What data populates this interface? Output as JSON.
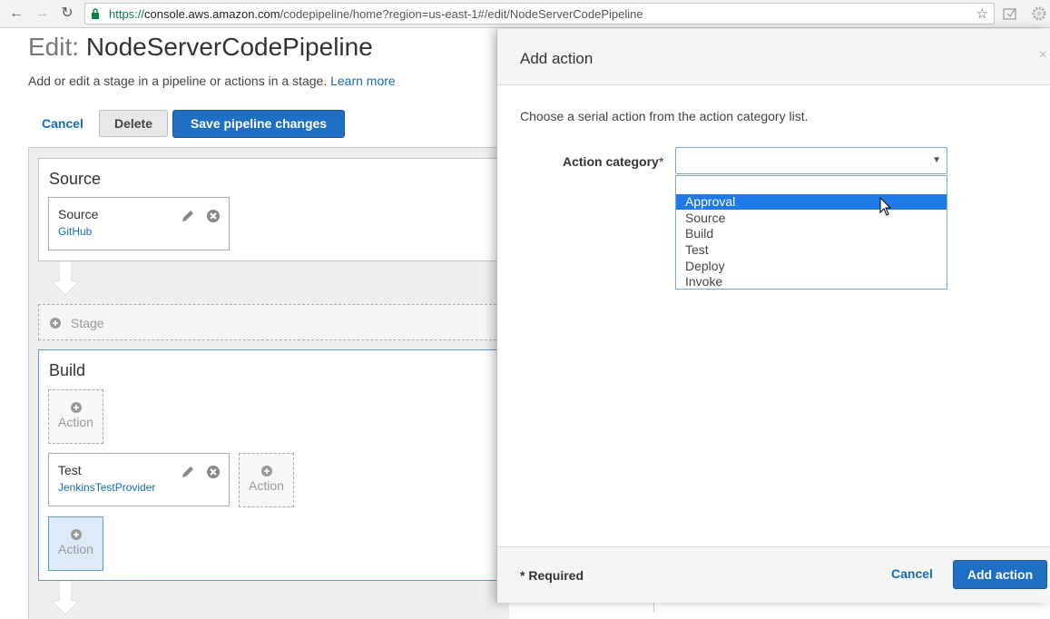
{
  "browser": {
    "url_scheme": "https://",
    "url_host": "console.aws.amazon.com",
    "url_path": "/codepipeline/home?region=us-east-1#/edit/NodeServerCodePipeline"
  },
  "page": {
    "title_prefix": "Edit:",
    "title_name": "NodeServerCodePipeline",
    "subtitle": "Add or edit a stage in a pipeline or actions in a stage.",
    "learn_more": "Learn more",
    "cancel_label": "Cancel",
    "delete_label": "Delete",
    "save_label": "Save pipeline changes"
  },
  "pipeline": {
    "source_stage": {
      "title": "Source",
      "action_name": "Source",
      "action_provider": "GitHub"
    },
    "add_stage_label": "Stage",
    "build_stage": {
      "title": "Build",
      "action_label": "Action",
      "test_action_name": "Test",
      "test_action_provider": "JenkinsTestProvider"
    }
  },
  "modal": {
    "title": "Add action",
    "close": "×",
    "instruction": "Choose a serial action from the action category list.",
    "field_label": "Action category",
    "required_mark": "*",
    "selected_value": "",
    "options": [
      "",
      "Approval",
      "Source",
      "Build",
      "Test",
      "Deploy",
      "Invoke"
    ],
    "highlighted_option": "Approval",
    "required_note": "* Required",
    "cancel_label": "Cancel",
    "add_label": "Add action"
  }
}
